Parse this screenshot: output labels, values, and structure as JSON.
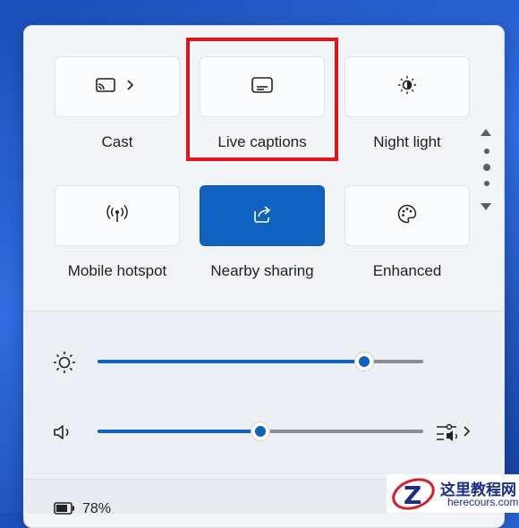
{
  "tiles": [
    {
      "label": "Cast",
      "icon": "cast-icon",
      "has_chevron": true
    },
    {
      "label": "Live captions",
      "icon": "captions-icon"
    },
    {
      "label": "Night light",
      "icon": "night-light-icon"
    },
    {
      "label": "Mobile hotspot",
      "icon": "hotspot-icon"
    },
    {
      "label": "Nearby sharing",
      "icon": "share-icon",
      "active": true
    },
    {
      "label": "Enhanced",
      "icon": "palette-icon"
    }
  ],
  "sliders": {
    "brightness": {
      "value": 0.82,
      "icon": "brightness-icon"
    },
    "volume": {
      "value": 0.5,
      "icon": "speaker-icon"
    }
  },
  "audio_output": {
    "icon": "audio-output-icon"
  },
  "battery": {
    "percent_text": "78%"
  },
  "watermark": {
    "title": "这里教程网",
    "subtitle": "herecours.com"
  },
  "colors": {
    "accent": "#0f62c0",
    "highlight": "#e0141a"
  }
}
